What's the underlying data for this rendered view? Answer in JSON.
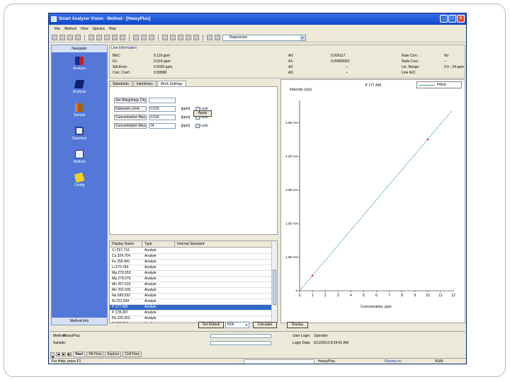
{
  "window": {
    "title": "Smart Analyzer Vision - Method - [HeavyPlus]",
    "minimize": "_",
    "maximize": "□",
    "close": "×"
  },
  "menu": [
    "File",
    "Method",
    "View",
    "Spectra",
    "Help"
  ],
  "toolbar": {
    "select_value": "Regression"
  },
  "nav": {
    "header": "Navigator",
    "footer": "Method Info",
    "items": [
      {
        "label": "Analyze",
        "icon": "analyze-icon"
      },
      {
        "label": "Analysis",
        "icon": "analysis-icon"
      },
      {
        "label": "Sample",
        "icon": "sample-icon"
      },
      {
        "label": "Standard",
        "icon": "standard-icon"
      },
      {
        "label": "Method",
        "icon": "method-icon"
      },
      {
        "label": "Config",
        "icon": "config-icon"
      }
    ]
  },
  "line_info": {
    "title": "Line Information",
    "col1": [
      {
        "label": "BEC:",
        "value": "0.119 ppm"
      },
      {
        "label": "DL:",
        "value": "0.019 ppm"
      },
      {
        "label": "Std Error:",
        "value": "0.0020 ppm"
      },
      {
        "label": "Corr. Coef.:",
        "value": "0.99998"
      }
    ],
    "col2": [
      {
        "label": "A0:",
        "value": "0.000117"
      },
      {
        "label": "A1:",
        "value": "0.00083662"
      },
      {
        "label": "A2:",
        "value": "--"
      },
      {
        "label": "A3:",
        "value": "--"
      }
    ],
    "col3": [
      {
        "label": "Rate Corr.:",
        "value": "No"
      },
      {
        "label": "Ratio Corr.:",
        "value": "--"
      },
      {
        "label": "Lin. Range:",
        "value": "0.0 - 24 ppm"
      },
      {
        "label": "Line IEC:",
        "value": ""
      }
    ]
  },
  "tabs": [
    "Standards",
    "Interferers",
    "Work Settings"
  ],
  "fields": [
    {
      "label": "Set Weightings (%):",
      "value": "",
      "unit": "",
      "check": ""
    },
    {
      "label": "Detection Limit:",
      "value": "0.019",
      "unit": "[ppm]",
      "check": "Lock"
    },
    {
      "label": "Concentration Max:",
      "value": "0.019",
      "unit": "[ppm]",
      "check": "Lock"
    },
    {
      "label": "Concentration Max:",
      "value": "24",
      "unit": "[ppm]",
      "check": "Lock"
    }
  ],
  "apply_label": "Apply",
  "table": {
    "headers": [
      "Display Name",
      "Type",
      "Internal Standard"
    ],
    "rows": [
      [
        "Cr 267.716",
        "Analyte",
        ""
      ],
      [
        "Cu 324.754",
        "Analyte",
        ""
      ],
      [
        "Fe 259.941",
        "Analyte",
        ""
      ],
      [
        "Li 670.784",
        "Analyte",
        ""
      ],
      [
        "Mg 279.553",
        "Analyte",
        ""
      ],
      [
        "Mg 279.079",
        "Analyte",
        ""
      ],
      [
        "Mn 257.610",
        "Analyte",
        ""
      ],
      [
        "Mo 202.030",
        "Analyte",
        ""
      ],
      [
        "Na 589.592",
        "Analyte",
        ""
      ],
      [
        "Ni 231.604",
        "Analyte",
        ""
      ],
      [
        "P 177.495",
        "Analyte",
        ""
      ],
      [
        "P 178.287",
        "Analyte",
        ""
      ],
      [
        "Pb 220.353",
        "Analyte",
        ""
      ],
      [
        "S 182.034",
        "Analyte",
        ""
      ],
      [
        "Si 185.006",
        "Analyte",
        ""
      ]
    ],
    "selected_row": 10
  },
  "chart_data": {
    "type": "scatter",
    "title": "P 177.495",
    "ylabel": "Intensity (cps)",
    "xlabel": "Concentration, ppm",
    "x_ticks": [
      "0",
      "1",
      "2",
      "3",
      "4",
      "5",
      "6",
      "7",
      "8",
      "9",
      "10",
      "11",
      "12"
    ],
    "y_ticks": [
      "0",
      "1.0E+04",
      "2.0E+04",
      "3.0E+04",
      "4.0E+04",
      "5.0E+04"
    ],
    "xlim": [
      0,
      12
    ],
    "ylim": [
      0,
      55000
    ],
    "legend": "Fitted",
    "legend_position": "top-right",
    "grid": true,
    "fitted_line": {
      "x": [
        0,
        11.9
      ],
      "y": [
        0,
        53700
      ]
    },
    "points": {
      "x": [
        1,
        10
      ],
      "y": [
        4500,
        45100
      ]
    }
  },
  "chart_buttons": {
    "display": "Display",
    "set_default": "Set Default",
    "select_value": "PDF",
    "calculate": "Calculate"
  },
  "bottom": {
    "method_label": "Method:",
    "method_value": "HeavyPlus",
    "sample_label": "Sample:",
    "user_label": "User Login:",
    "user_value": "Operator",
    "login_label": "Login Date:",
    "login_value": "6/12/2013 8:34:51 AM"
  },
  "sheet_tabs": [
    "Start",
    "Hit Flow",
    "Explore",
    "Cell Flow"
  ],
  "status": {
    "help": "For Help, press F1",
    "method": "HeavyPlus",
    "plasma": "Plasma on",
    "num": "NUM"
  }
}
